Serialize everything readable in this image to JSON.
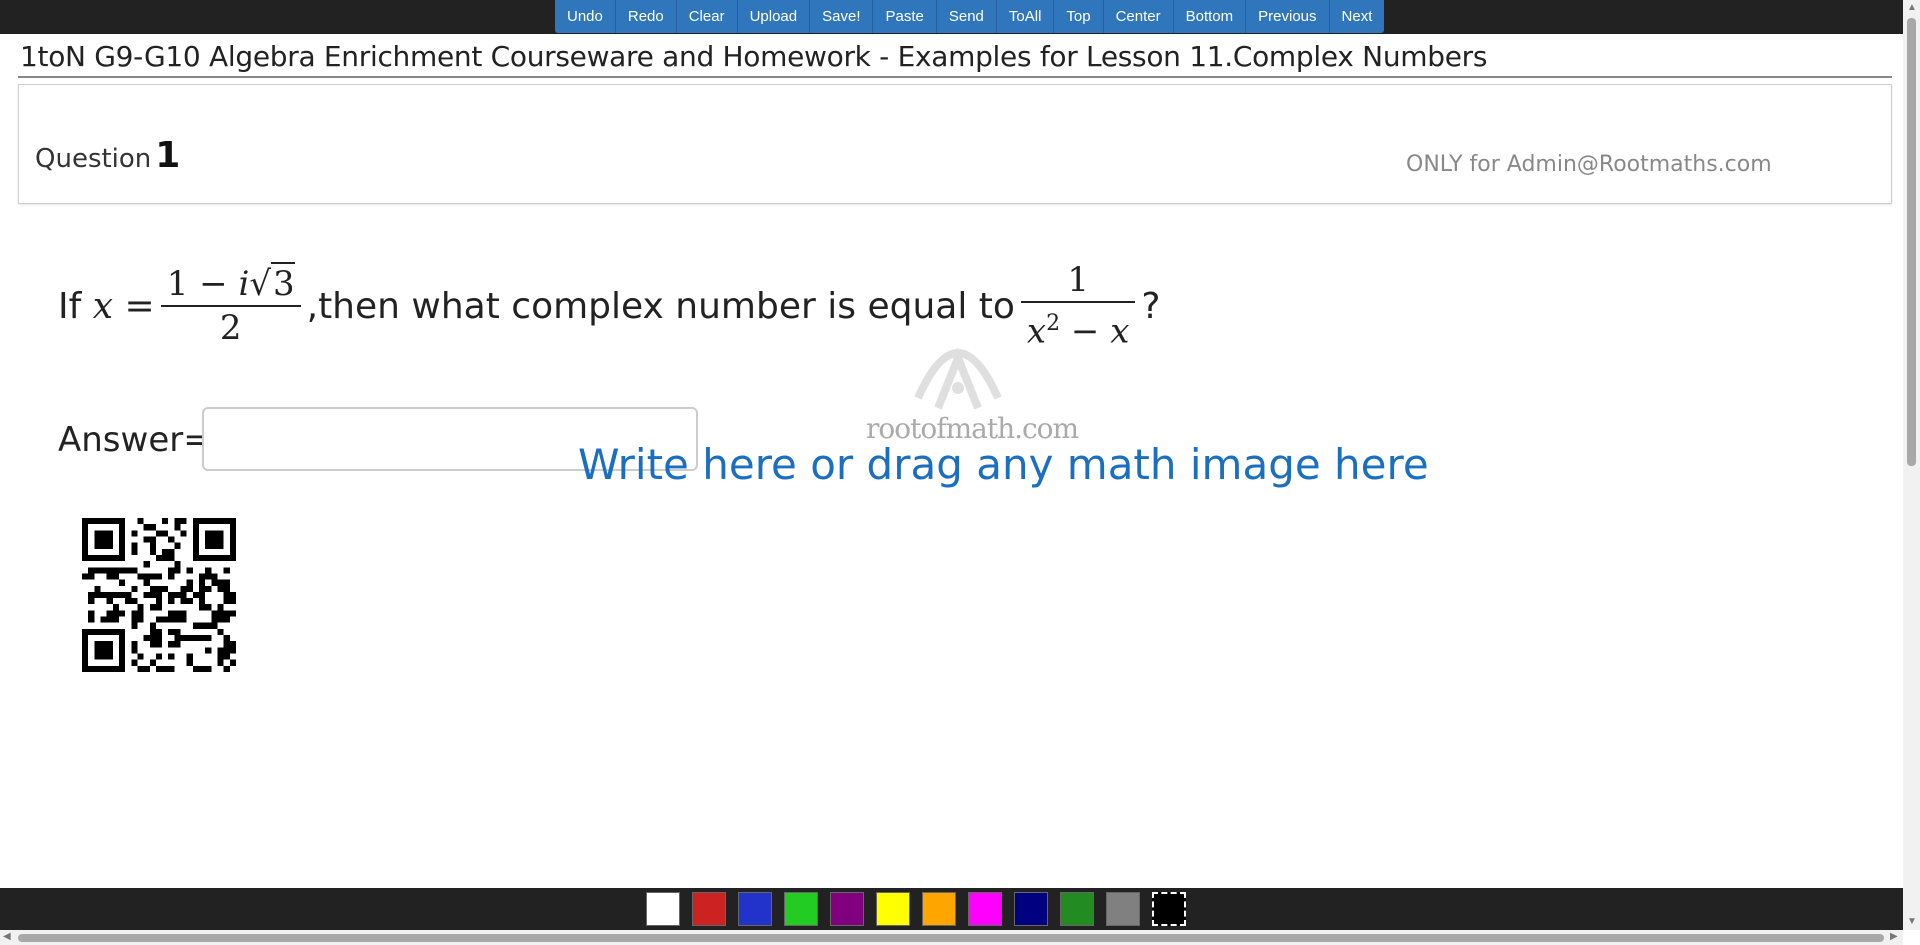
{
  "toolbar": {
    "buttons": [
      "Undo",
      "Redo",
      "Clear",
      "Upload",
      "Save!",
      "Paste",
      "Send",
      "ToAll",
      "Top",
      "Center",
      "Bottom",
      "Previous",
      "Next"
    ]
  },
  "page": {
    "title": "1toN G9-G10 Algebra Enrichment Courseware and Homework - Examples for Lesson 11.Complex Numbers"
  },
  "question": {
    "label": "Question",
    "number": "1",
    "owner": "ONLY for Admin@Rootmaths.com"
  },
  "problem": {
    "prefix": "If",
    "var": "x",
    "eq": "=",
    "num1_a": "1 − ",
    "num1_i": "i",
    "num1_root": "3",
    "den1": "2",
    "middle": ",then what complex number is equal to",
    "num2": "1",
    "den2_x1": "x",
    "den2_sup": "2",
    "den2_rest": " − ",
    "den2_x2": "x",
    "suffix": "?"
  },
  "answer": {
    "label": "Answer=",
    "value": ""
  },
  "hint": "Write here or drag any math image here",
  "watermark": "rootofmath.com",
  "palette": {
    "colors": [
      "#ffffff",
      "#cc2222",
      "#2233cc",
      "#22cc22",
      "#800080",
      "#ffff00",
      "#ffa500",
      "#ff00ff",
      "#000080",
      "#228b22",
      "#808080",
      "#000000"
    ]
  }
}
